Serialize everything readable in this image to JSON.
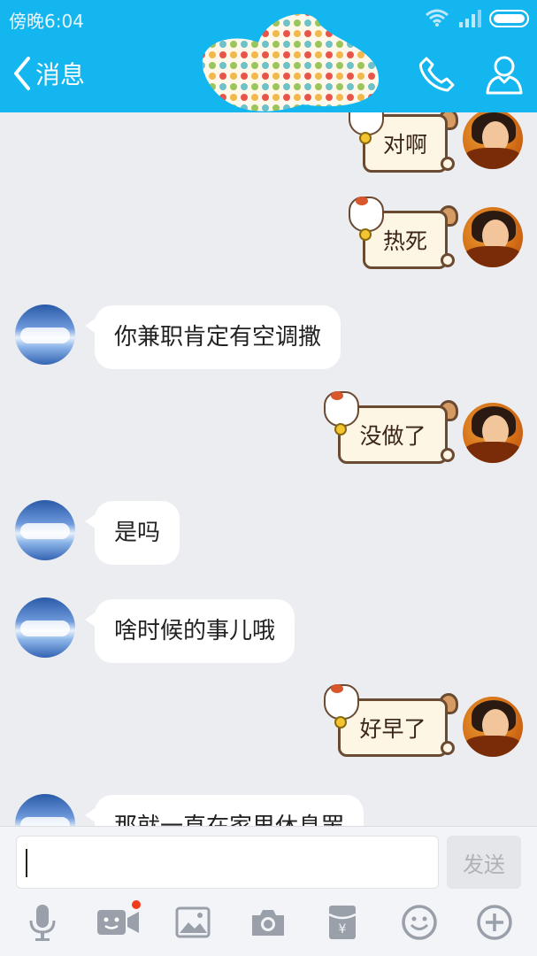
{
  "status_bar": {
    "time": "傍晚6:04"
  },
  "header": {
    "back_label": "消息"
  },
  "messages": [
    {
      "side": "right",
      "type": "sticker",
      "text": "对啊"
    },
    {
      "side": "right",
      "type": "sticker",
      "text": "热死"
    },
    {
      "side": "left",
      "type": "text",
      "text": "你兼职肯定有空调撒"
    },
    {
      "side": "right",
      "type": "sticker",
      "text": "没做了"
    },
    {
      "side": "left",
      "type": "text",
      "text": "是吗"
    },
    {
      "side": "left",
      "type": "text",
      "text": "啥时候的事儿哦"
    },
    {
      "side": "right",
      "type": "sticker",
      "text": "好早了"
    },
    {
      "side": "left",
      "type": "text",
      "text": "那就一直在家里休息罢"
    }
  ],
  "input": {
    "value": "",
    "send_label": "发送"
  },
  "toolbar": {
    "items": [
      "microphone-icon",
      "video-icon",
      "image-icon",
      "camera-icon",
      "red-packet-icon",
      "emoji-icon",
      "plus-icon"
    ]
  },
  "colors": {
    "header": "#14b6ef",
    "background": "#ebedf1",
    "unread_dot": "#f33b1b"
  }
}
